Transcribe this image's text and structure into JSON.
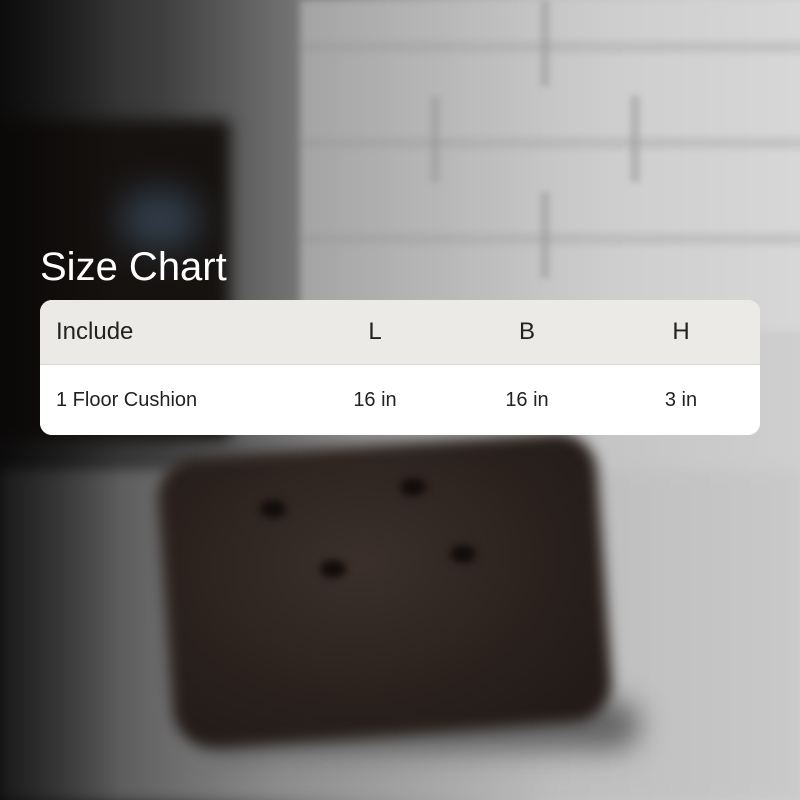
{
  "title": "Size Chart",
  "table": {
    "headers": [
      "Include",
      "L",
      "B",
      "H"
    ],
    "rows": [
      [
        "1 Floor Cushion",
        "16 in",
        "16 in",
        "3 in"
      ]
    ]
  },
  "colors": {
    "title_text": "#ffffff",
    "header_bg": "#ebeae6",
    "body_bg": "#ffffff",
    "cell_text": "#222222"
  }
}
